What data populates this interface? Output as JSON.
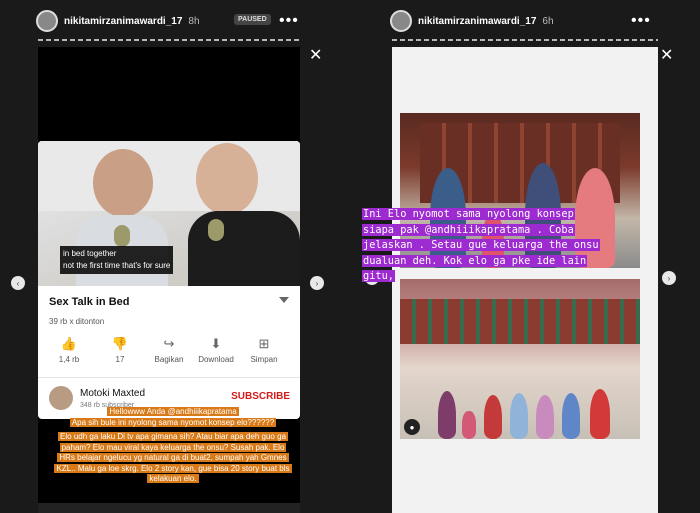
{
  "left_story": {
    "username": "nikitamirzanimawardi_17",
    "time": "8h",
    "paused_badge": "PAUSED",
    "more": "•••",
    "close": "✕",
    "video": {
      "subtitle_line1": "in bed together",
      "subtitle_line2": "not the first time that's for sure",
      "title": "Sex Talk in Bed",
      "views": "39 rb x ditonton",
      "actions": [
        {
          "icon": "thumbs-up-icon",
          "label": "1,4 rb"
        },
        {
          "icon": "thumbs-down-icon",
          "label": "17"
        },
        {
          "icon": "share-icon",
          "label": "Bagikan"
        },
        {
          "icon": "download-icon",
          "label": "Download"
        },
        {
          "icon": "save-icon",
          "label": "Simpan"
        }
      ],
      "channel_name": "Motoki Maxted",
      "subscribers": "348 rb subscriber",
      "subscribe_label": "SUBSCRIBE"
    },
    "caption": [
      "Hellowww Anda @andhiiikapratama",
      "Apa sih bule ini nyolong sama nyomot konsep elo??????",
      "Elo udh ga laku Di tv apa gimana sih? Atau biar apa deh guo ga paham? Elo mau viral kaya keluarga the onsu? Susah pak. Elo HRs belajar ngelucu yg natural ga di buat2, sumpah yah Gmnes KZL.. Malu ga loe skrg. Elo 2 story kan, gue bisa 20 story buat bls kelakuan elo."
    ]
  },
  "right_story": {
    "username": "nikitamirzanimawardi_17",
    "time": "6h",
    "more": "•••",
    "close": "✕",
    "caption": "Ini Elo nyomot sama nyolong konsep siapa pak @andhiiikapratama . Coba jelaskan . Setau gue keluarga the onsu dualuan deh. Kok elo ga pke ide lain gitu,"
  },
  "nav": {
    "prev": "‹",
    "next": "›"
  }
}
